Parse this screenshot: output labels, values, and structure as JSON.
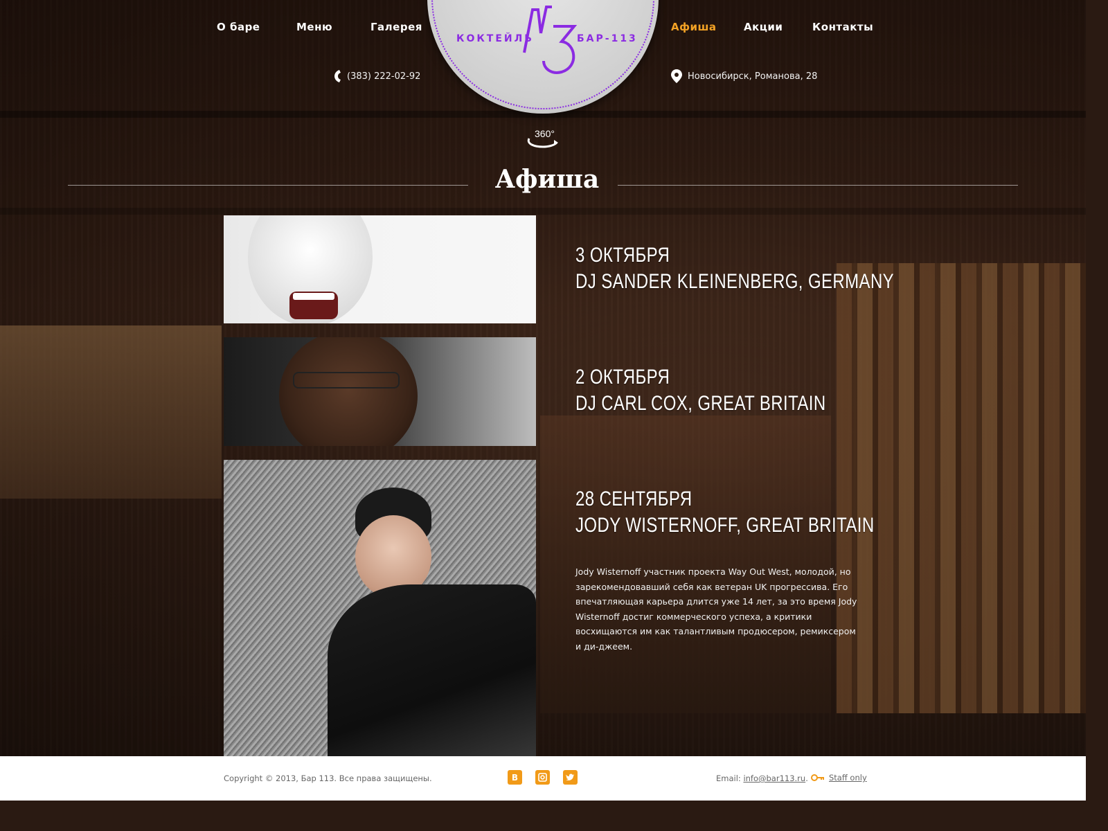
{
  "nav": {
    "left": [
      "О баре",
      "Меню",
      "Галерея"
    ],
    "right": [
      "Афиша",
      "Акции",
      "Контакты"
    ],
    "active": "Афиша"
  },
  "logo": {
    "left_text": "КОКТЕЙЛЬ",
    "right_text": "БАР-113"
  },
  "contacts": {
    "phone": "(383) 222-02-92",
    "address": "Новосибирск, Романова, 28"
  },
  "pano_label": "360°",
  "section_title": "Афиша",
  "events": [
    {
      "date": "3 ОКТЯБРЯ",
      "name": "DJ SANDER KLEINENBERG, GERMANY"
    },
    {
      "date": "2 ОКТЯБРЯ",
      "name": "DJ CARL COX, GREAT BRITAIN"
    },
    {
      "date": "28 СЕНТЯБРЯ",
      "name": "JODY WISTERNOFF, GREAT BRITAIN",
      "description": "Jody Wisternoff участник проекта Way Out West, молодой, но зарекомендовавший себя как ветеран UK прогрессива. Его впечатляющая карьера длится уже 14 лет, за это время Jody Wisternoff достиг коммерческого успеха, а критики восхищаются им как талантливым продюсером, ремиксером и ди-джеем."
    }
  ],
  "footer": {
    "copyright": "Copyright © 2013, Бар 113. Все права защищены.",
    "social": [
      "vk-icon",
      "instagram-icon",
      "twitter-icon"
    ],
    "email_label": "Email: ",
    "email": "info@bar113.ru",
    "email_suffix": ".",
    "staff": "Staff only"
  },
  "colors": {
    "accent": "#f3a225",
    "brand": "#8b2be2",
    "footer_bg": "#ffffff"
  }
}
